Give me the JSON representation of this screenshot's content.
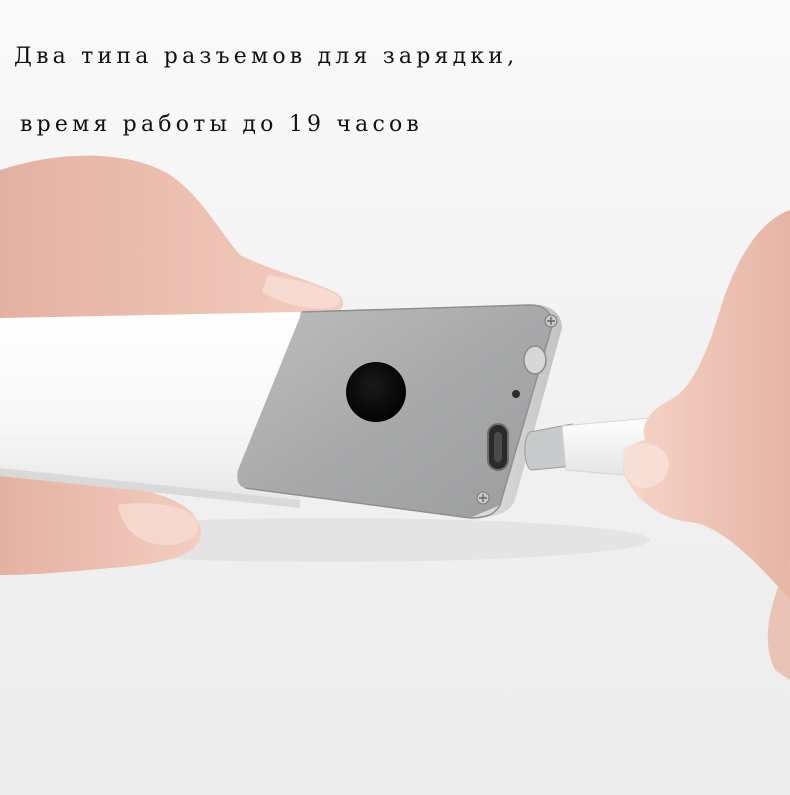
{
  "caption": {
    "line1": "Два типа разъемов для зарядки,",
    "line2": "время работы до 19 часов"
  },
  "photo": {
    "background_color": "#f3f3f4",
    "tube_color": "#fbfbfb",
    "cap_color": "#a9aaab",
    "sensor_color": "#070707",
    "skin_color": "#f2c7ba"
  }
}
